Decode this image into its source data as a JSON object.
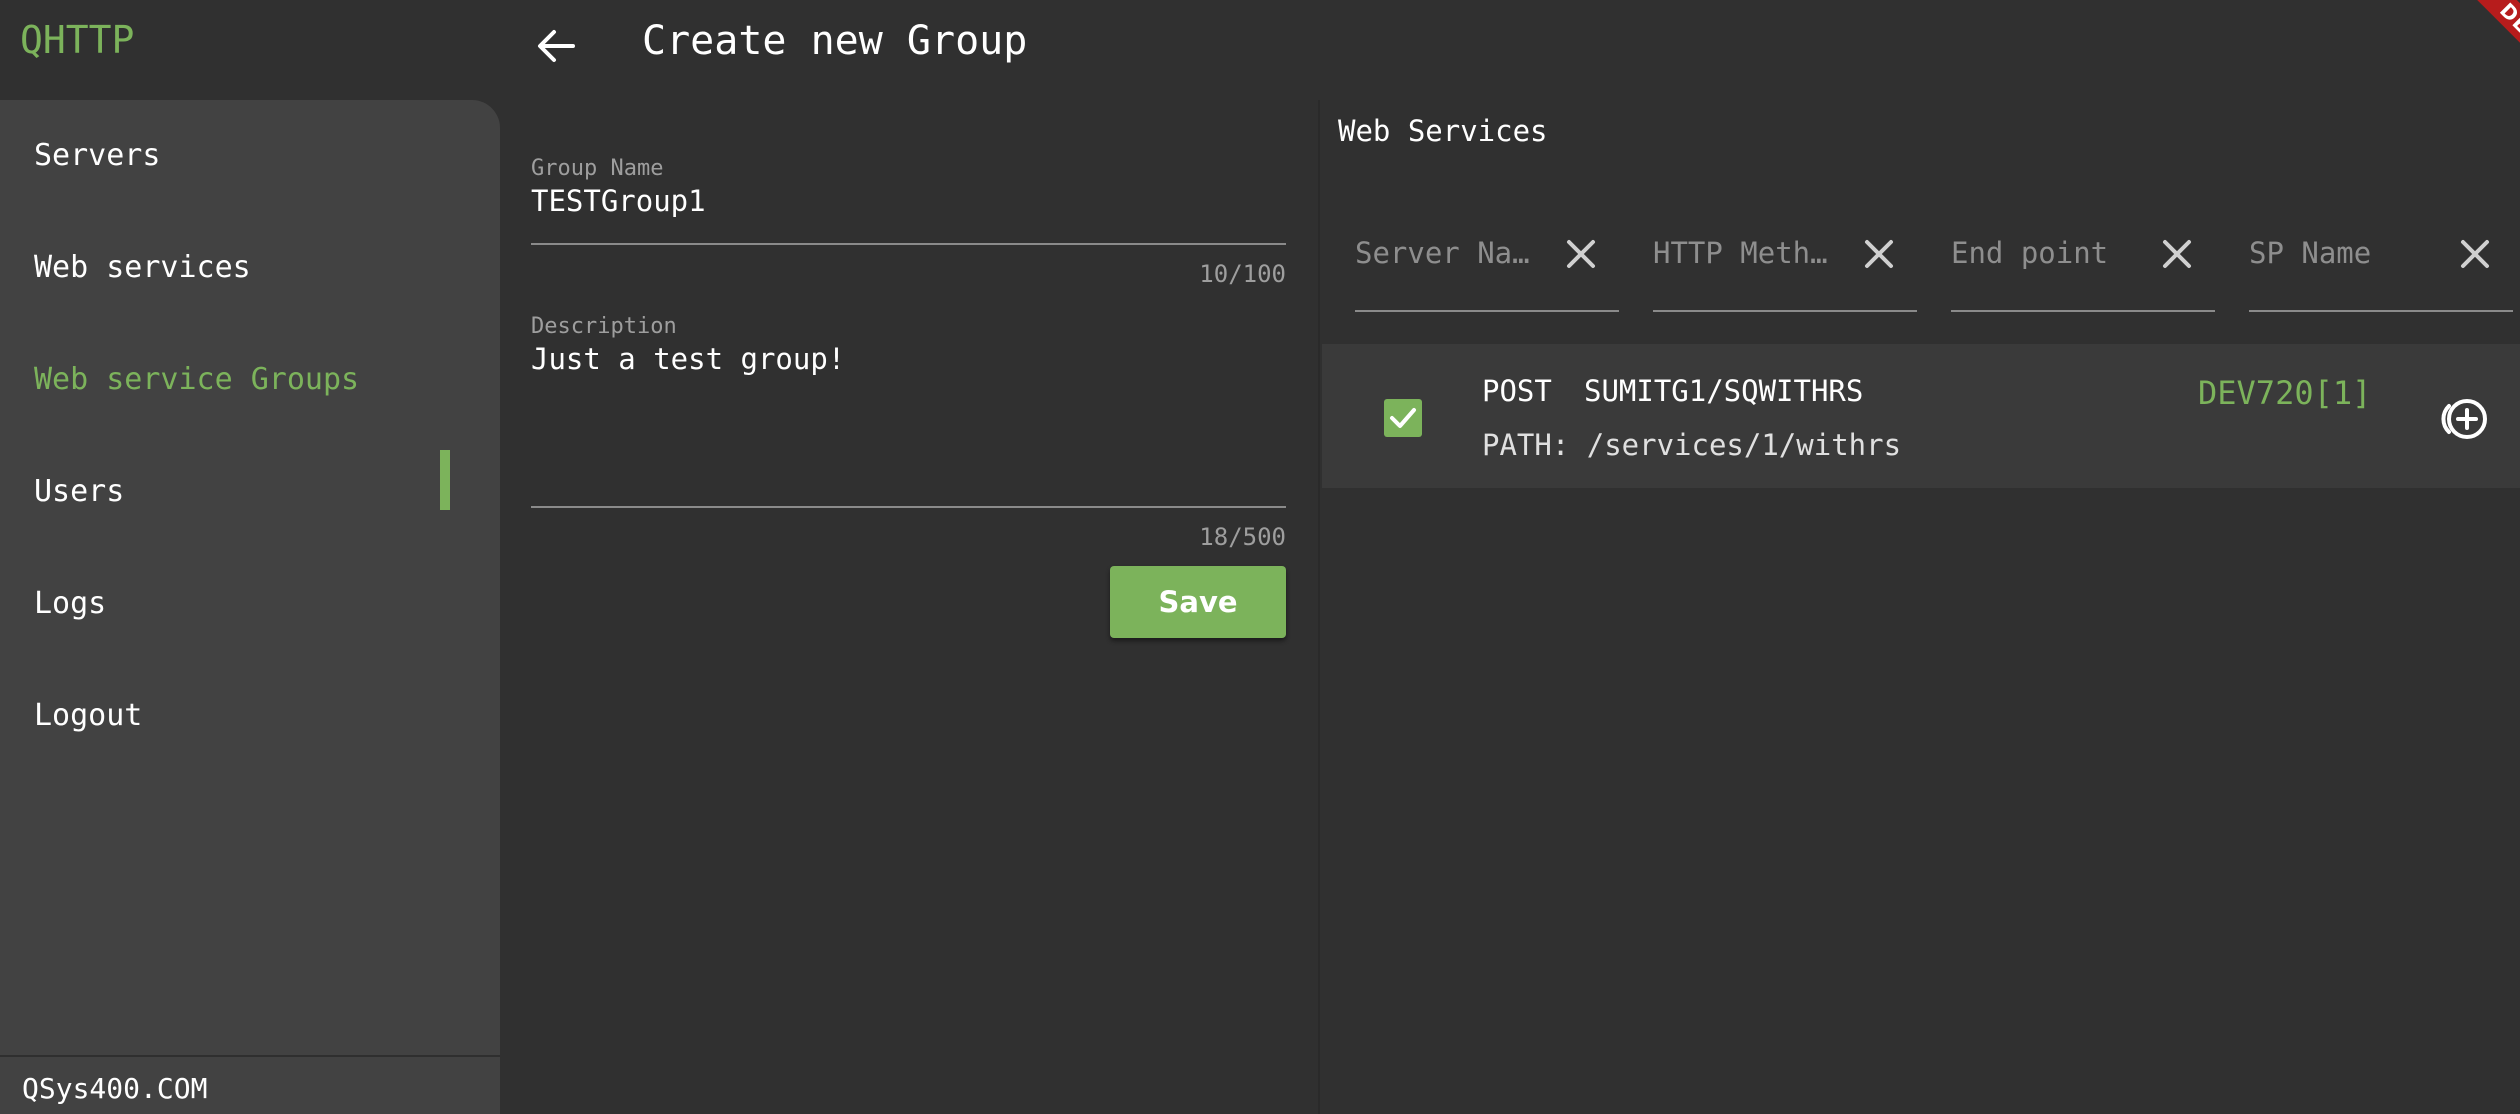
{
  "app": {
    "brand": "QHTTP",
    "footer": "QSys400.COM",
    "debug_banner": "DEBUG"
  },
  "header": {
    "title": "Create new Group",
    "back_icon": "arrow-left-icon"
  },
  "sidebar": {
    "items": [
      {
        "label": "Servers"
      },
      {
        "label": "Web services"
      },
      {
        "label": "Web service Groups",
        "active": true
      },
      {
        "label": "Users"
      },
      {
        "label": "Logs"
      },
      {
        "label": "Logout"
      }
    ]
  },
  "form": {
    "group_name": {
      "label": "Group Name",
      "value": "TESTGroup1",
      "counter": "10/100"
    },
    "description": {
      "label": "Description",
      "value": "Just a test group!",
      "counter": "18/500"
    },
    "save_label": "Save"
  },
  "web_services": {
    "title": "Web Services",
    "filters": [
      {
        "placeholder": "Server Na…"
      },
      {
        "placeholder": "HTTP Meth…"
      },
      {
        "placeholder": "End point"
      },
      {
        "placeholder": "SP Name"
      }
    ],
    "rows": [
      {
        "method": "POST",
        "endpoint": "SUMITG1/SQWITHRS",
        "path": "PATH: /services/1/withrs",
        "server": "DEV720[1]",
        "checked": true
      }
    ]
  },
  "colors": {
    "accent": "#7cb35b",
    "background": "#303030",
    "sidebar": "#424242",
    "row": "#3a3a3a"
  }
}
